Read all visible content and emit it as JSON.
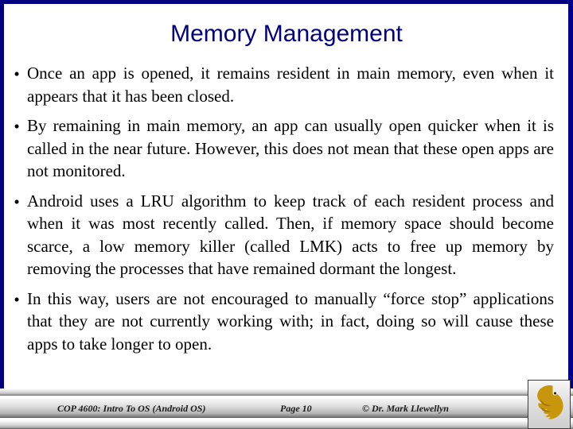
{
  "slide": {
    "title": "Memory Management",
    "title_color": "#000080",
    "frame_color": "#000080",
    "background_color": "#ffffff",
    "bullet_glyph": "•",
    "bullets": [
      "Once an app is opened, it remains resident in main memory, even when it appears that it has been closed.",
      "By remaining in main memory, an app can usually open quicker when it is called in the near future.  However, this does not mean that these open apps are not monitored.",
      "Android uses a LRU algorithm to keep track of each resident process and when it was most recently called.  Then, if memory space should become scarce, a low memory killer (called LMK) acts to free up memory by removing the processes that have remained dormant the longest.",
      "In this way, users are not encouraged to manually “force stop” applications that they are not currently working with; in fact, doing so will cause these apps to take longer to open."
    ]
  },
  "footer": {
    "course": "COP 4600: Intro To OS  (Android OS)",
    "page": "Page 10",
    "copyright": "© Dr. Mark Llewellyn",
    "logo_name": "ucf-pegasus-logo",
    "logo_color": "#c8960c"
  }
}
